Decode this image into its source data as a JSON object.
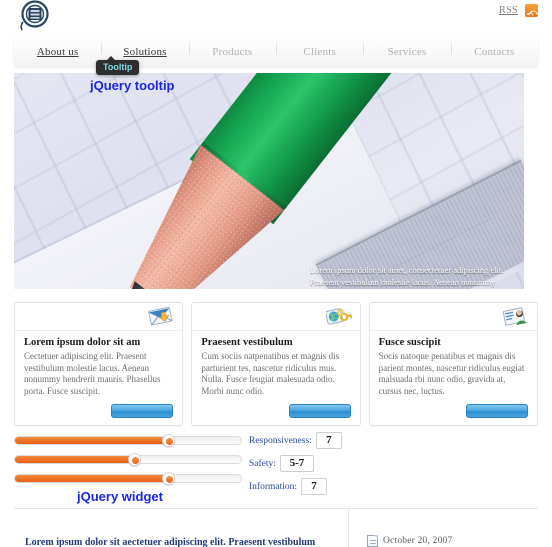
{
  "header": {
    "logo_alt": "site-logo",
    "rss_label": "RSS",
    "rss_icon": "rss-icon"
  },
  "nav": {
    "items": [
      {
        "label": "About us",
        "active": true
      },
      {
        "label": "Solutions",
        "active": true
      },
      {
        "label": "Products",
        "active": false
      },
      {
        "label": "Clients",
        "active": false
      },
      {
        "label": "Services",
        "active": false
      },
      {
        "label": "Contacts",
        "active": false
      }
    ]
  },
  "tooltip": {
    "text": "Tooltip"
  },
  "annotations": {
    "tooltip_note": "jQuery tooltip",
    "widget_note": "jQuery widget"
  },
  "hero": {
    "overlay_text": "Lorem ipsum dolor sit amet, consectetuer adipiscing elit. Praesent vestibulum molestie lacus. Aenean nonummy hendrerit mauris.",
    "image_description": "green-pencil-on-graph-paper"
  },
  "cards": [
    {
      "icon": "mail-download-icon",
      "title": "Lorem ipsum dolor sit am",
      "text": "Cectetuer adipiscing elit. Praesent vestibulum molestie lacus. Aenean nonummy hendrerit mauris. Phasellus porta. Fusce suscipit.",
      "button_label": ""
    },
    {
      "icon": "globe-keys-icon",
      "title": "Praesent vestibulum",
      "text": "Cum sociis natpenatibus et magnis dis parturient tes, nascetur ridiculus mus. Nulla. Fusce feugiat malesuada odio. Morbi nunc odio.",
      "button_label": ""
    },
    {
      "icon": "user-card-icon",
      "title": "Fusce suscipit",
      "text": "Socis natoque penatibus et magnis dis parient montes, nascetur ridiculus eugiat malsuada rbi nunc odio, gravida at, cursus nec, luctus.",
      "button_label": ""
    }
  ],
  "sliders": [
    {
      "name": "responsiveness-slider",
      "percent": 68
    },
    {
      "name": "safety-slider",
      "percent": 53
    },
    {
      "name": "information-slider",
      "percent": 68
    }
  ],
  "fields": [
    {
      "label": "Responsiveness:",
      "value": "7",
      "wide": false
    },
    {
      "label": "Safety:",
      "value": "5-7",
      "wide": true
    },
    {
      "label": "Information:",
      "value": "7",
      "wide": false
    }
  ],
  "footer": {
    "post_title": "Lorem ipsum dolor sit aectetuer adipiscing elit. Praesent vestibulum",
    "date_icon": "document-icon",
    "date": "October 20, 2007"
  },
  "colors": {
    "accent_orange": "#ea5e11",
    "annotation_blue": "#1a26e0",
    "link_blue": "#223a7a",
    "button_blue": "#2e8fd1",
    "tooltip_bg": "#2e2e2e",
    "tooltip_fg": "#7fdbe8"
  }
}
